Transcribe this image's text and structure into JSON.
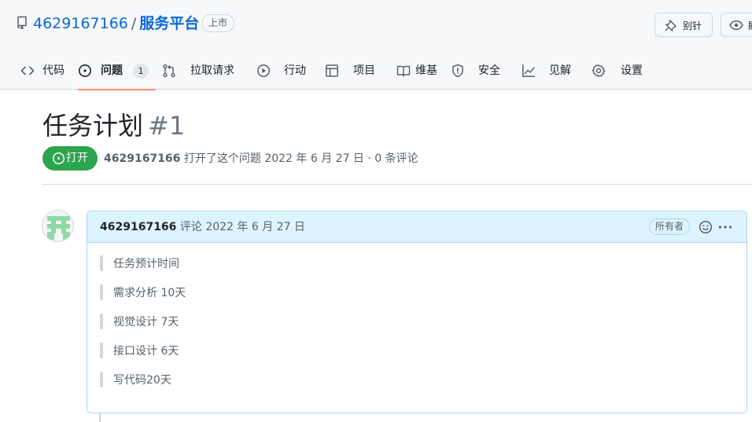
{
  "repo": {
    "owner": "4629167166",
    "separator": "/",
    "name": "服务平台",
    "visibility": "上市"
  },
  "actions": {
    "pin_label": "别针",
    "watch_label": "顯"
  },
  "tabs": [
    {
      "label": "代码",
      "icon": "code-icon"
    },
    {
      "label": "问题",
      "icon": "issue-opened-icon",
      "count": "1",
      "selected": true
    },
    {
      "label": "拉取请求",
      "icon": "git-pull-request-icon"
    },
    {
      "label": "行动",
      "icon": "play-icon"
    },
    {
      "label": "项目",
      "icon": "table-icon"
    },
    {
      "label": "维基",
      "icon": "book-icon"
    },
    {
      "label": "安全",
      "icon": "shield-icon"
    },
    {
      "label": "见解",
      "icon": "graph-icon"
    },
    {
      "label": "设置",
      "icon": "gear-icon"
    }
  ],
  "issue": {
    "title": "任务计划",
    "number": "#1",
    "state": "打开",
    "author": "4629167166",
    "meta": " 打开了这个问题 2022 年 6 月 27 日 · 0 条评论"
  },
  "comment": {
    "author": "4629167166",
    "meta": " 评论 2022 年 6 月 27 日",
    "role_badge": "所有者",
    "quotes": [
      "任务预计时间",
      "需求分析 10天",
      "视觉设计 7天",
      "接口设计 6天",
      "写代码20天"
    ]
  },
  "colors": {
    "accent": "#0969da",
    "open_state": "#2da44e",
    "selected_tab_underline": "#fd8c73",
    "comment_header": "#ddf4ff",
    "avatar": "#8fd9a8"
  }
}
